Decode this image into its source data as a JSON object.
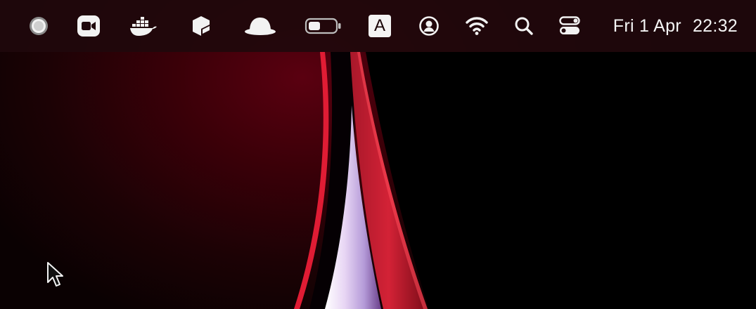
{
  "menubar": {
    "status_items": [
      {
        "name": "record-indicator-icon"
      },
      {
        "name": "zoom-icon"
      },
      {
        "name": "docker-icon"
      },
      {
        "name": "app-cube-icon"
      },
      {
        "name": "bowler-hat-icon"
      },
      {
        "name": "battery-icon"
      },
      {
        "name": "input-source-icon",
        "label": "A"
      },
      {
        "name": "user-account-icon"
      },
      {
        "name": "wifi-icon"
      },
      {
        "name": "spotlight-search-icon"
      },
      {
        "name": "control-center-icon"
      }
    ],
    "date": "Fri 1 Apr",
    "time": "22:32"
  },
  "colors": {
    "menubar_bg": "#20080c",
    "wallpaper_red": "#5a0010",
    "wallpaper_accent": "#e8243c",
    "wallpaper_lilac": "#d8c8ee"
  },
  "cursor": {
    "name": "mouse-pointer-icon"
  }
}
